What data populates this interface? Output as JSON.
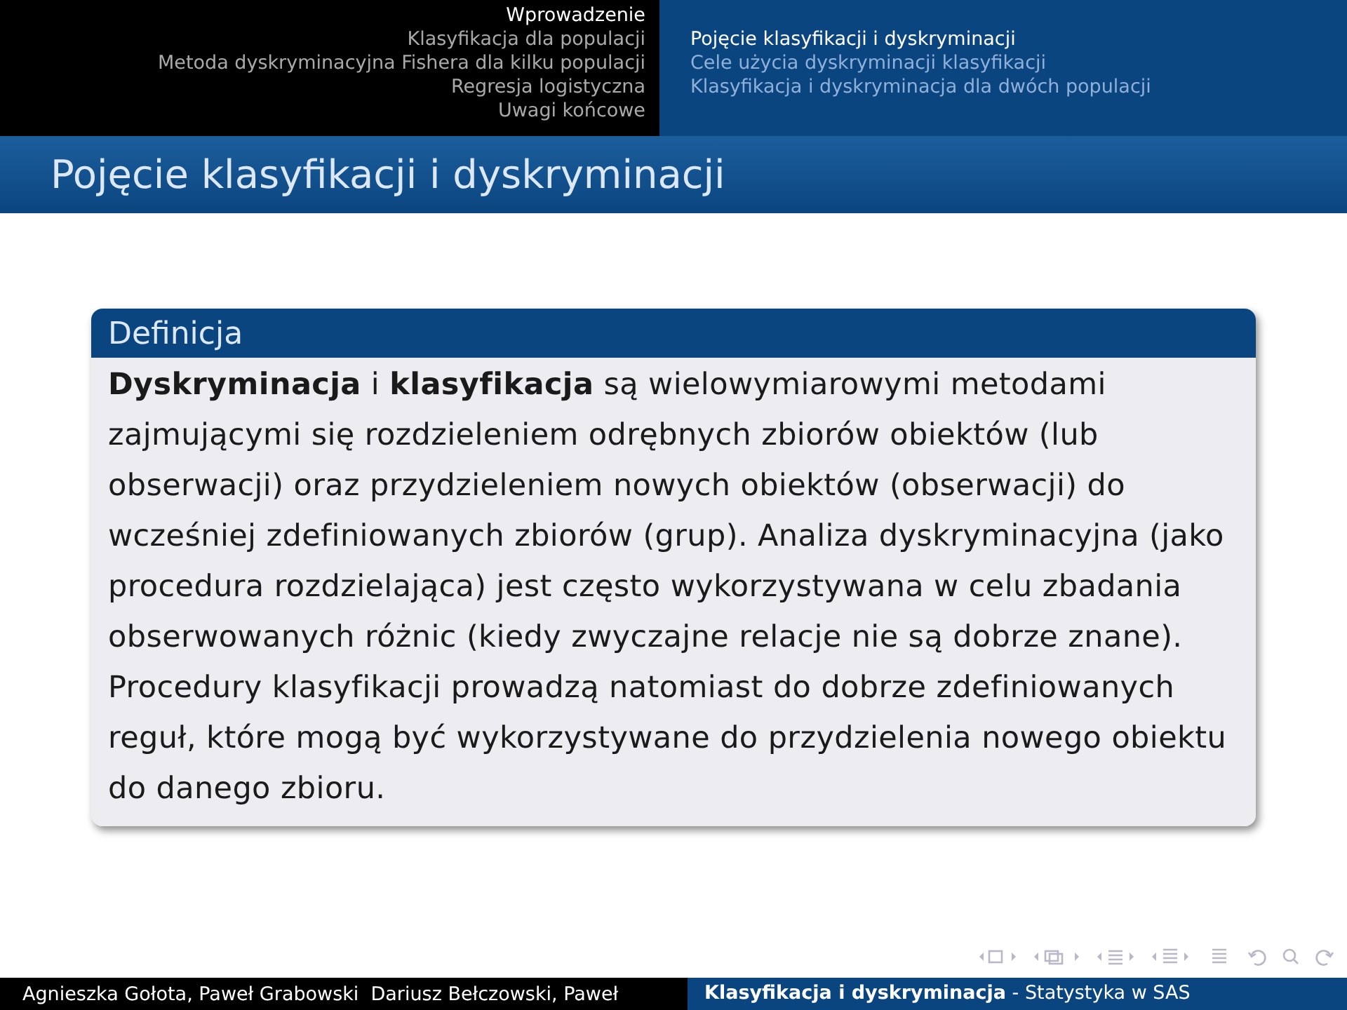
{
  "header": {
    "sections": [
      {
        "label": "Wprowadzenie",
        "selected": true
      },
      {
        "label": "Klasyfikacja dla populacji",
        "selected": false
      },
      {
        "label": "Metoda dyskryminacyjna Fishera dla kilku populacji",
        "selected": false
      },
      {
        "label": "Regresja logistyczna",
        "selected": false
      },
      {
        "label": "Uwagi końcowe",
        "selected": false
      }
    ],
    "subsections": [
      {
        "label": "Pojęcie klasyfikacji i dyskryminacji",
        "selected": true
      },
      {
        "label": "Cele użycia dyskryminacji klasyfikacji",
        "selected": false
      },
      {
        "label": "Klasyfikacja i dyskryminacja dla dwóch populacji",
        "selected": false
      }
    ]
  },
  "frame_title": "Pojęcie klasyfikacji i dyskryminacji",
  "block": {
    "title": "Definicja",
    "text": "**Dyskryminacja** i **klasyfikacja** są wielowymiarowymi metodami zajmującymi się rozdzieleniem odrębnych zbiorów obiektów (lub obserwacji) oraz przydzieleniem nowych obiektów (obserwacji) do wcześniej zdefiniowanych zbiorów (grup). Analiza dyskryminacyjna (jako procedura rozdzielająca) jest często wykorzystywana w celu zbadania obserwowanych różnic (kiedy zwyczajne relacje nie są dobrze znane). Procedury klasyfikacji prowadzą natomiast do dobrze zdefiniowanych reguł, które mogą być wykorzystywane do przydzielenia nowego obiektu do danego zbioru."
  },
  "footer": {
    "authors": "Agnieszka Gołota, Paweł Grabowski  Dariusz Bełczowski, Paweł",
    "title": "**Klasyfikacja i dyskryminacja** - Statystyka w SAS"
  }
}
